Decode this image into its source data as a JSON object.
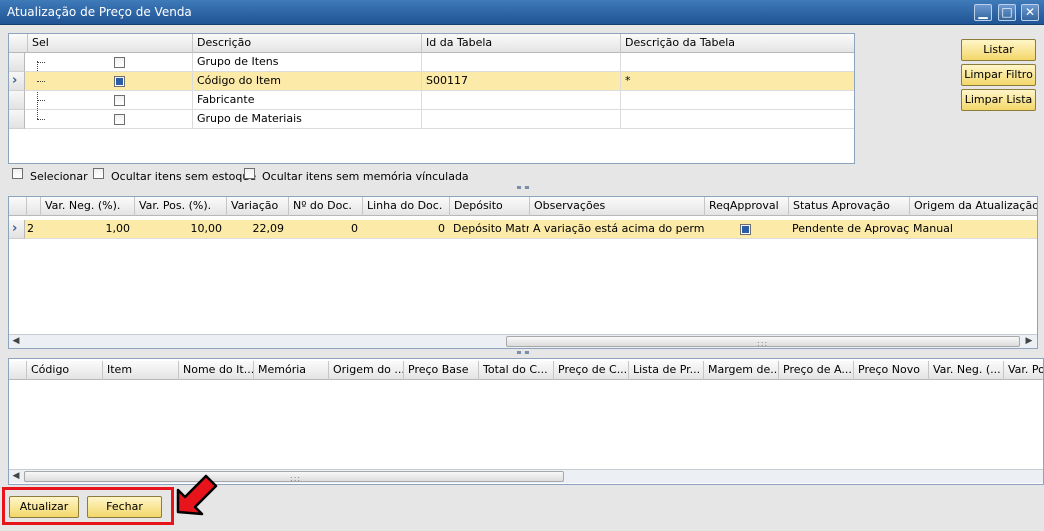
{
  "window": {
    "title": "Atualização de Preço de Venda"
  },
  "filter_grid": {
    "columns": [
      "Sel",
      "Descrição",
      "Id da Tabela",
      "Descrição da Tabela"
    ],
    "rows": [
      {
        "checked": false,
        "descricao": "Grupo de Itens",
        "id_tabela": "",
        "desc_tabela": ""
      },
      {
        "checked": true,
        "descricao": "Código do Item",
        "id_tabela": "S00117",
        "desc_tabela": "*"
      },
      {
        "checked": false,
        "descricao": "Fabricante",
        "id_tabela": "",
        "desc_tabela": ""
      },
      {
        "checked": false,
        "descricao": "Grupo de Materiais",
        "id_tabela": "",
        "desc_tabela": ""
      }
    ]
  },
  "side_buttons": {
    "listar": "Listar",
    "limpar_filtro": "Limpar Filtro",
    "limpar_lista": "Limpar Lista"
  },
  "options": {
    "selecionar": "Selecionar",
    "ocultar_estoque": "Ocultar itens sem estoque",
    "ocultar_memoria": "Ocultar itens sem memória vínculada"
  },
  "approval_grid": {
    "columns": [
      "Var. Neg. (%).",
      "Var. Pos. (%).",
      "Variação",
      "Nº do Doc.",
      "Linha do Doc.",
      "Depósito",
      "Observações",
      "ReqApproval",
      "Status Aprovação",
      "Origem da Atualização"
    ],
    "row": {
      "first": "2",
      "var_neg": "1,00",
      "var_pos": "10,00",
      "variacao": "22,09",
      "n_doc": "0",
      "linha_doc": "0",
      "deposito": "Depósito Matriz",
      "observacoes": "A variação está acima do permitido",
      "req_approval": true,
      "status": "Pendente de Aprovação",
      "origem": "Manual"
    }
  },
  "items_grid": {
    "columns": [
      "Código",
      "Item",
      "Nome do It...",
      "Memória",
      "Origem do ...",
      "Preço Base",
      "Total do C...",
      "Preço de C...",
      "Lista de Pr...",
      "Margem de...",
      "Preço de A...",
      "Preço Novo",
      "Var. Neg. (...",
      "Var. Po"
    ]
  },
  "footer": {
    "atualizar": "Atualizar",
    "fechar": "Fechar"
  },
  "colors": {
    "title_bar": "#2b63a6",
    "selected_row": "#fbeaa8",
    "button": "#f3d76a",
    "highlight": "#e8141c"
  }
}
